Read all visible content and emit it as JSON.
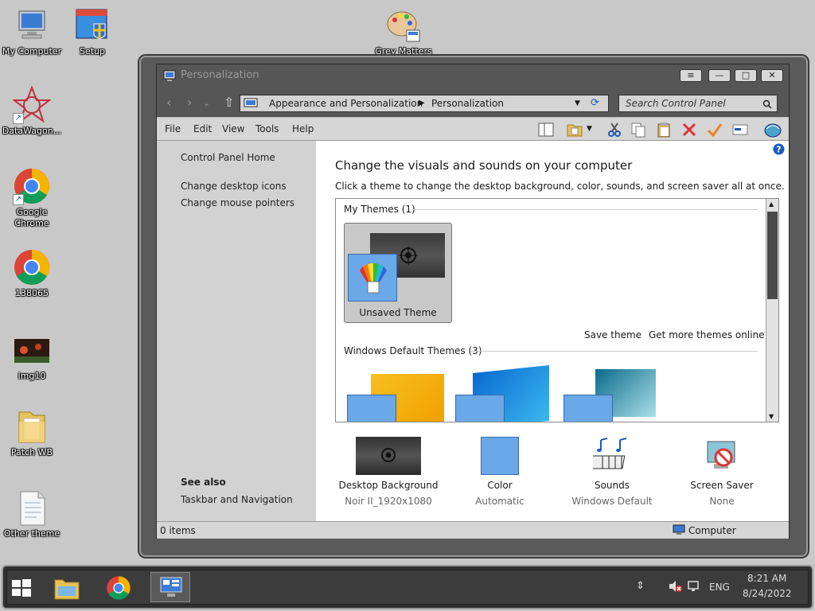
{
  "desktop": {
    "icons": [
      {
        "label": "My Computer",
        "icon": "computer-icon"
      },
      {
        "label": "Setup",
        "icon": "setup-icon"
      },
      {
        "label": "Grey Matters",
        "icon": "palette-icon"
      },
      {
        "label": "DataWagon...",
        "icon": "datawagon-icon"
      },
      {
        "label": "Google Chrome",
        "icon": "chrome-icon"
      },
      {
        "label": "138065",
        "icon": "chrome-icon"
      },
      {
        "label": "img10",
        "icon": "image-icon"
      },
      {
        "label": "Patch WB",
        "icon": "folder-icon"
      },
      {
        "label": "Other theme",
        "icon": "text-file-icon"
      }
    ]
  },
  "window": {
    "title": "Personalization",
    "buttons": {
      "menu": "≡",
      "minimize": "—",
      "maximize": "□",
      "close": "✕"
    },
    "breadcrumb": [
      "Appearance and Personalization",
      "Personalization"
    ],
    "search_placeholder": "Search Control Panel",
    "menu": [
      "File",
      "Edit",
      "View",
      "Tools",
      "Help"
    ]
  },
  "sidebar": {
    "home": "Control Panel Home",
    "links": [
      "Change desktop icons",
      "Change mouse pointers"
    ],
    "see_also_title": "See also",
    "see_also": [
      "Taskbar and Navigation"
    ]
  },
  "content": {
    "heading": "Change the visuals and sounds on your computer",
    "subheading": "Click a theme to change the desktop background, color, sounds, and screen saver all at once.",
    "my_themes_label": "My Themes (1)",
    "my_themes": [
      {
        "name": "Unsaved Theme"
      }
    ],
    "save_theme": "Save theme",
    "get_more": "Get more themes online",
    "default_themes_label": "Windows Default Themes (3)",
    "settings": [
      {
        "title": "Desktop Background",
        "value": "Noir II_1920x1080"
      },
      {
        "title": "Color",
        "value": "Automatic"
      },
      {
        "title": "Sounds",
        "value": "Windows Default"
      },
      {
        "title": "Screen Saver",
        "value": "None"
      }
    ]
  },
  "statusbar": {
    "items": "0 items",
    "location": "Computer"
  },
  "taskbar": {
    "tray_lang": "ENG",
    "time": "8:21 AM",
    "date": "8/24/2022"
  },
  "colors": {
    "accent": "#1a73e8",
    "selected_tile": "#c8c8c8",
    "window_chrome": "#565656"
  }
}
